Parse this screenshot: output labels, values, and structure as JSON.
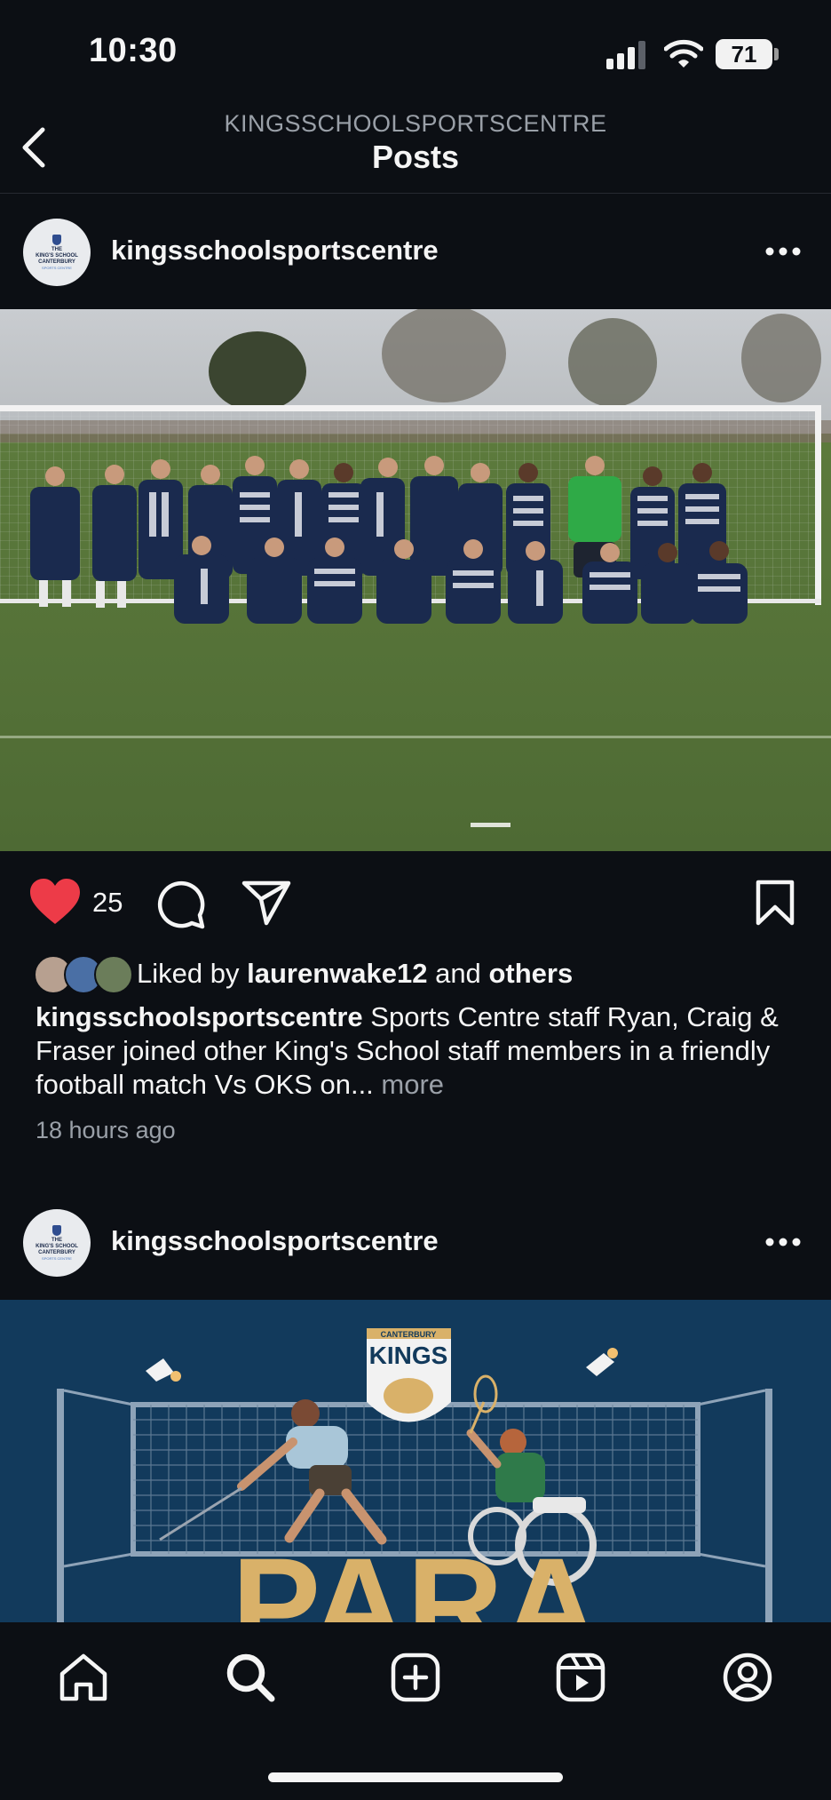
{
  "status_bar": {
    "time": "10:30",
    "battery": "71"
  },
  "header": {
    "account": "KINGSSCHOOLSPORTSCENTRE",
    "title": "Posts"
  },
  "post1": {
    "avatar_text": [
      "THE",
      "KING'S SCHOOL",
      "CANTERBURY"
    ],
    "avatar_sub": "SPORTS CENTRE",
    "username": "kingsschoolsportscentre",
    "image_icon": "football-team-photo",
    "likes": "25",
    "liked_prefix": "Liked by",
    "liked_user": "laurenwake12",
    "liked_and": "and",
    "liked_others": "others",
    "caption_user": "kingsschoolsportscentre",
    "caption_text": "Sports Centre staff Ryan, Craig & Fraser joined other King's School staff members in a friendly football match Vs OKS on...",
    "caption_more": "more",
    "time_ago": "18 hours ago"
  },
  "post2": {
    "avatar_text": [
      "THE",
      "KING'S SCHOOL",
      "CANTERBURY"
    ],
    "avatar_sub": "SPORTS CENTRE",
    "username": "kingsschoolsportscentre",
    "badge_small": "CANTERBURY",
    "badge_big": "KINGS",
    "big_text": "PARA"
  },
  "colors": {
    "like": "#ed3b48",
    "background": "#0c0f14",
    "muted": "#9aa0a8",
    "poster_bg": "#123a5c",
    "poster_gold": "#d9b169"
  },
  "nav": {
    "items": [
      "home-icon",
      "search-icon",
      "create-icon",
      "reels-icon",
      "profile-icon"
    ]
  }
}
